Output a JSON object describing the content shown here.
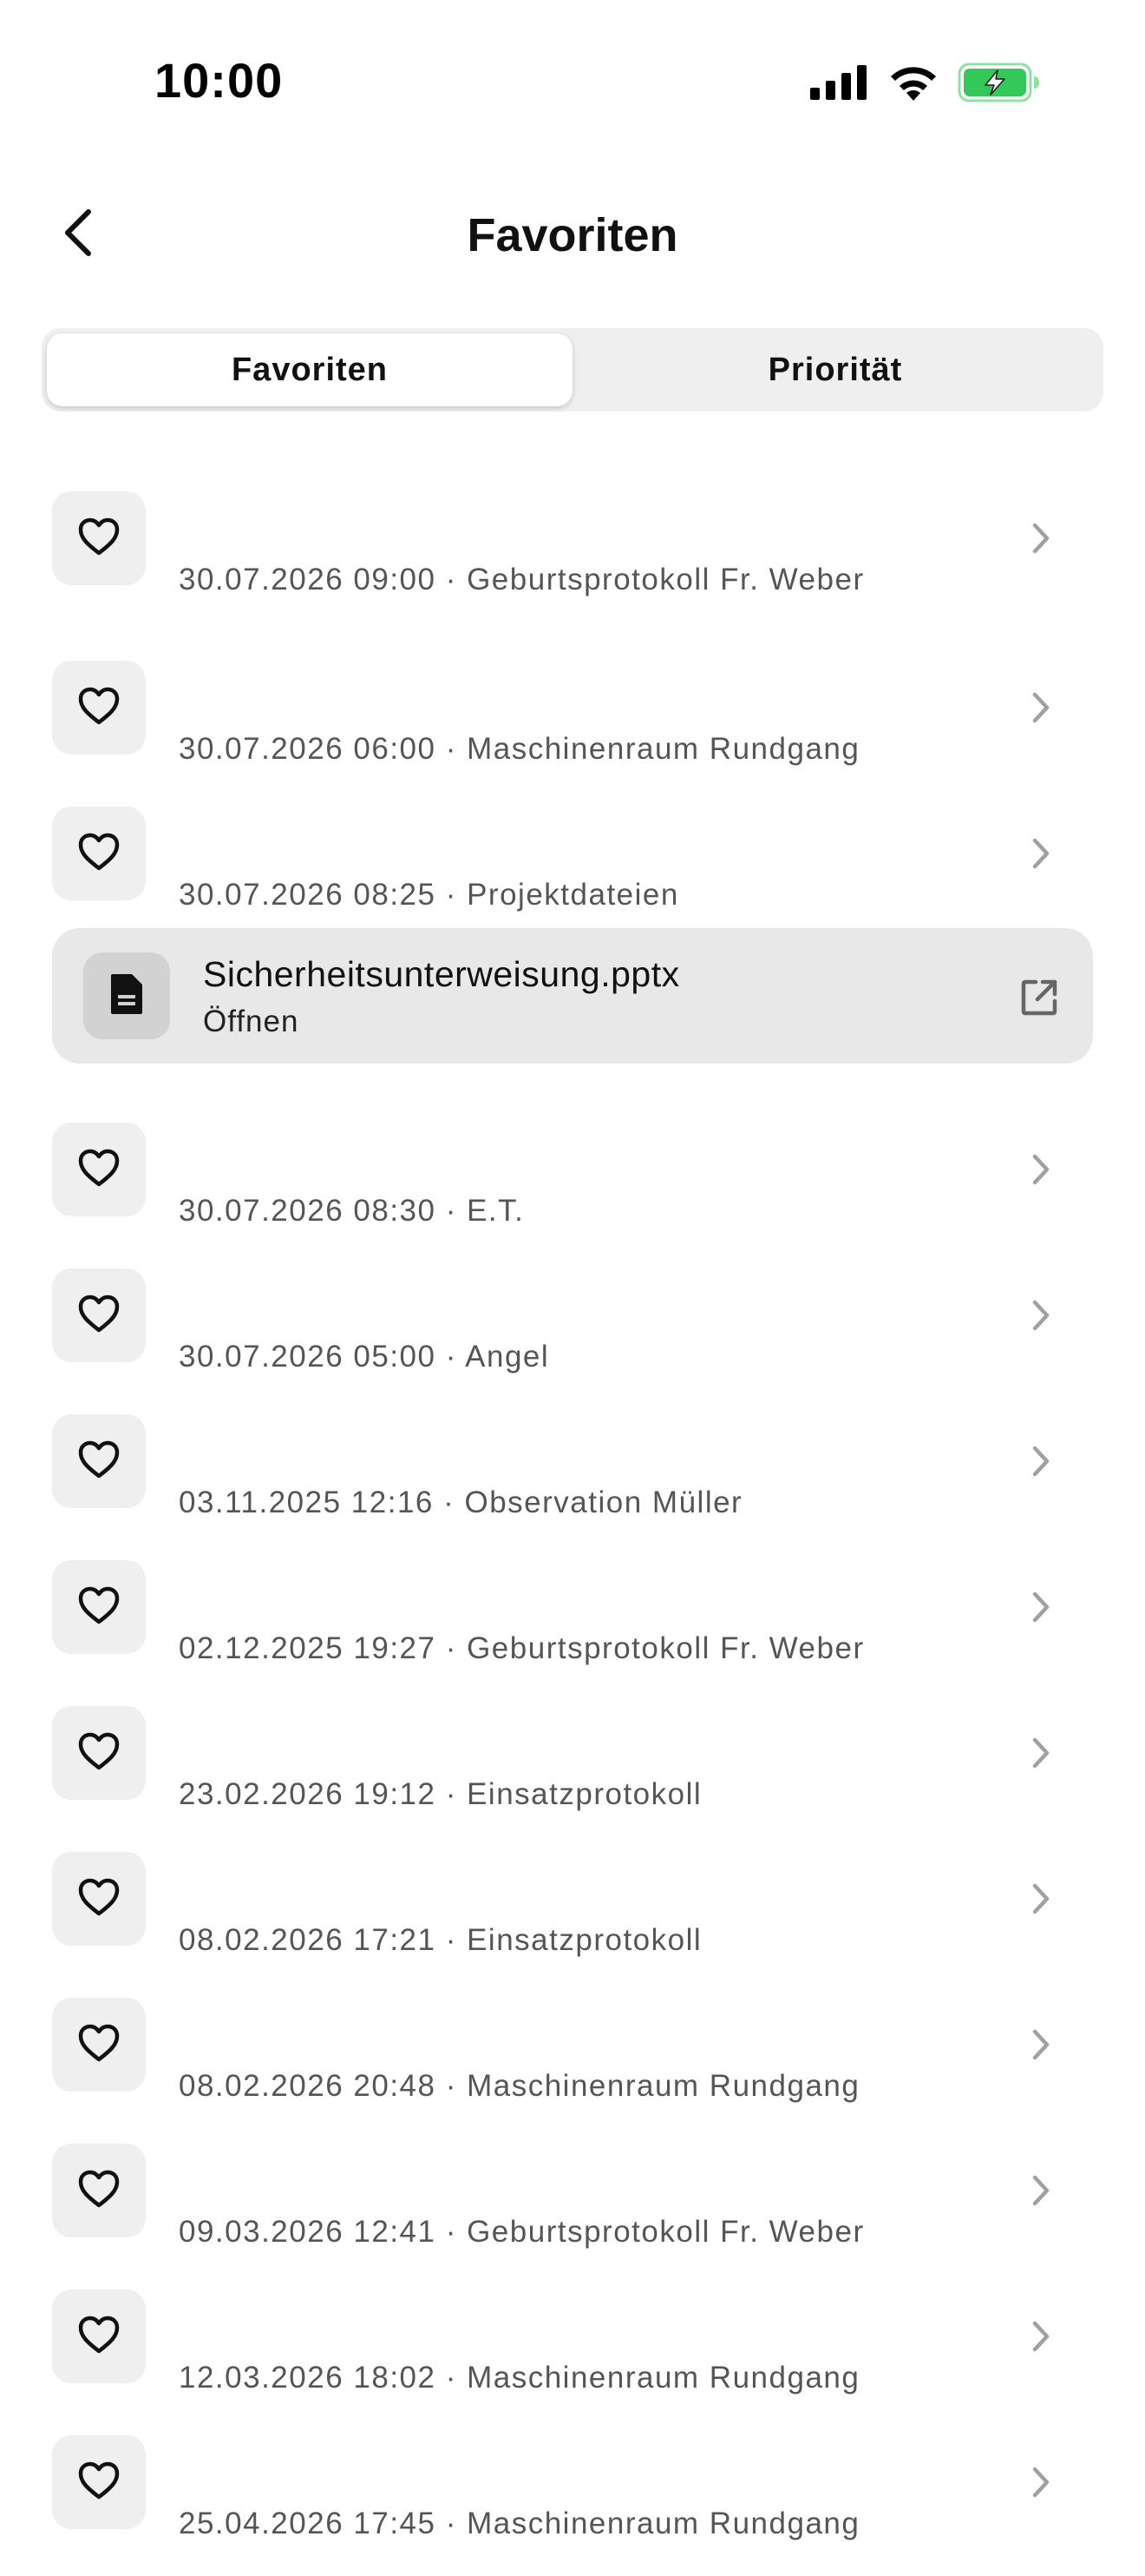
{
  "status_bar": {
    "time": "10:00",
    "icons": [
      "cellular-signal-icon",
      "wifi-icon",
      "battery-charging-icon"
    ],
    "battery_color": "#34c759"
  },
  "nav": {
    "title": "Favoriten",
    "back_icon": "chevron-left-icon"
  },
  "segments": {
    "favorites": "Favoriten",
    "priority": "Priorität",
    "selected": "Favoriten"
  },
  "list": {
    "items": [
      {
        "text": "30.07.2026 09:00 · Geburtsprotokoll Fr. Weber"
      },
      {
        "text": "30.07.2026 06:00 · Maschinenraum Rundgang"
      },
      {
        "text": "30.07.2026 08:25 · Projektdateien"
      },
      {
        "text": "30.07.2026 08:30 · E.T."
      },
      {
        "text": "30.07.2026 05:00 · Angel"
      },
      {
        "text": "03.11.2025 12:16 · Observation Müller"
      },
      {
        "text": "02.12.2025 19:27 · Geburtsprotokoll Fr. Weber"
      },
      {
        "text": "23.02.2026 19:12 · Einsatzprotokoll"
      },
      {
        "text": "08.02.2026 17:21 · Einsatzprotokoll"
      },
      {
        "text": "08.02.2026 20:48 · Maschinenraum Rundgang"
      },
      {
        "text": "09.03.2026 12:41 · Geburtsprotokoll Fr. Weber"
      },
      {
        "text": "12.03.2026 18:02 · Maschinenraum Rundgang"
      },
      {
        "text": "25.04.2026 17:45 · Maschinenraum Rundgang"
      }
    ],
    "file": {
      "name": "Sicherheitsunterweisung.pptx",
      "action": "Öffnen",
      "icon": "document-icon",
      "open_icon": "open-external-icon"
    }
  },
  "colors": {
    "tile_background": "#efefef",
    "file_card_background": "#e8e8e8",
    "secondary_text": "#555555",
    "chevron": "#a0a0a0"
  }
}
